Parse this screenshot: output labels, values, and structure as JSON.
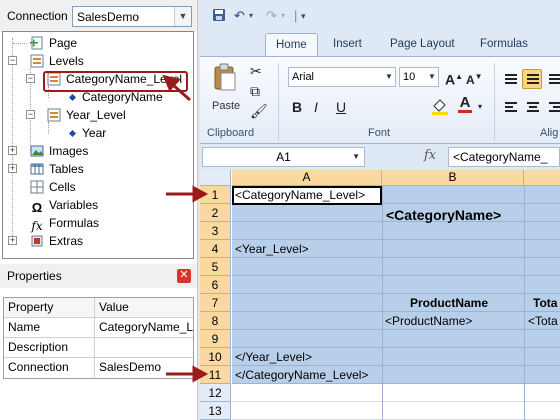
{
  "connection": {
    "label": "Connection",
    "value": "SalesDemo"
  },
  "tree": {
    "items": [
      {
        "label": "Page"
      },
      {
        "label": "Levels"
      },
      {
        "label": "CategoryName_Level"
      },
      {
        "label": "CategoryName"
      },
      {
        "label": "Year_Level"
      },
      {
        "label": "Year"
      },
      {
        "label": "Images"
      },
      {
        "label": "Tables"
      },
      {
        "label": "Cells"
      },
      {
        "label": "Variables"
      },
      {
        "label": "Formulas"
      },
      {
        "label": "Extras"
      }
    ]
  },
  "properties": {
    "title": "Properties",
    "headers": [
      "Property",
      "Value"
    ],
    "rows": [
      {
        "key": "Name",
        "value": "CategoryName_L"
      },
      {
        "key": "Description",
        "value": ""
      },
      {
        "key": "Connection",
        "value": "SalesDemo"
      }
    ]
  },
  "excel": {
    "tabs": [
      "Home",
      "Insert",
      "Page Layout",
      "Formulas"
    ],
    "active_tab": "Home",
    "ribbon": {
      "clipboard_label": "Clipboard",
      "paste_label": "Paste",
      "font_label": "Font",
      "alignment_label": "Alig",
      "font_name": "Arial",
      "font_size": "10"
    },
    "name_box": "A1",
    "fx": "fx",
    "formula": "<CategoryName_",
    "columns": [
      "A",
      "B"
    ],
    "rows": [
      "1",
      "2",
      "3",
      "4",
      "5",
      "6",
      "7",
      "8",
      "9",
      "10",
      "11",
      "12",
      "13"
    ],
    "cells": {
      "a1": "<CategoryName_Level>",
      "b2": "<CategoryName>",
      "a4": "<Year_Level>",
      "b7": "ProductName",
      "c7": "Tota",
      "b8": "<ProductName>",
      "c8": "<Tota",
      "a10": "</Year_Level>",
      "a11": "</CategoryName_Level>"
    }
  },
  "colors": {
    "accent_red": "#9b1b1b",
    "selection_blue": "#b8cfe9",
    "header_highlight": "#f9d99f",
    "ribbon_blue": "#dfe9f5"
  }
}
